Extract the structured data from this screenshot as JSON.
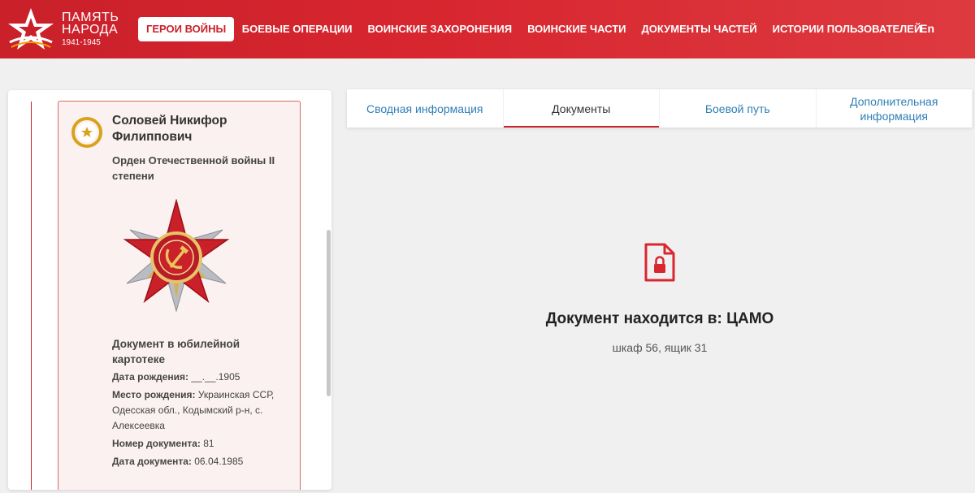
{
  "header": {
    "logo_line1": "ПАМЯТЬ",
    "logo_line2": "НАРОДА",
    "logo_years": "1941-1945",
    "nav": [
      {
        "label": "ГЕРОИ ВОЙНЫ",
        "active": true
      },
      {
        "label": "БОЕВЫЕ ОПЕРАЦИИ"
      },
      {
        "label": "ВОИНСКИЕ ЗАХОРОНЕНИЯ"
      },
      {
        "label": "ВОИНСКИЕ ЧАСТИ"
      },
      {
        "label": "ДОКУМЕНТЫ ЧАСТЕЙ"
      },
      {
        "label": "ИСТОРИИ ПОЛЬЗОВАТЕЛЕЙ"
      }
    ],
    "lang": "En"
  },
  "card": {
    "name": "Соловей Никифор Филиппович",
    "award": "Орден Отечественной войны II степени",
    "doc_title": "Документ в юбилейной картотеке",
    "fields": [
      {
        "label": "Дата рождения:",
        "value": " __.__.1905"
      },
      {
        "label": "Место рождения:",
        "value": " Украинская ССР, Одесская обл., Кодымский р-н, с. Алексеевка"
      },
      {
        "label": "Номер документа:",
        "value": " 81"
      },
      {
        "label": "Дата документа:",
        "value": " 06.04.1985"
      }
    ]
  },
  "tabs": [
    {
      "label": "Сводная информация"
    },
    {
      "label": "Документы",
      "active": true
    },
    {
      "label": "Боевой путь"
    },
    {
      "label": "Дополнительная информация"
    }
  ],
  "document": {
    "location": "Документ находится в: ЦАМО",
    "shelf": "шкаф 56, ящик 31"
  },
  "colors": {
    "brand_red": "#c9202a",
    "link_blue": "#2f7fb5",
    "gold": "#d9a21b"
  }
}
